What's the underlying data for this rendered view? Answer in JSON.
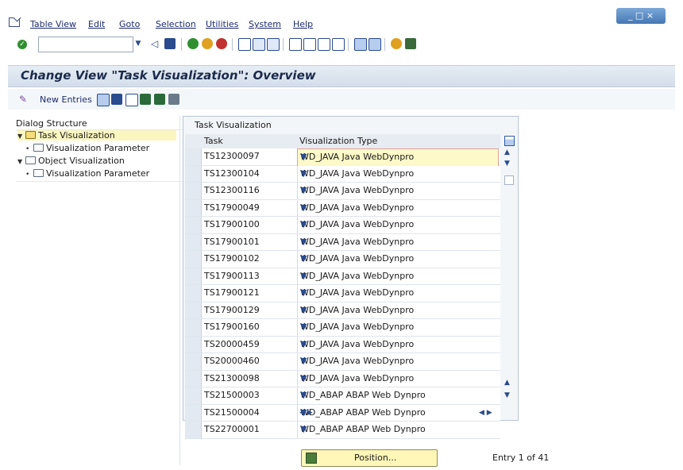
{
  "menu": {
    "items": [
      "Table View",
      "Edit",
      "Goto",
      "Selection",
      "Utilities",
      "System",
      "Help"
    ]
  },
  "window_controls": "_ □ ×",
  "title": "Change View \"Task Visualization\": Overview",
  "app_toolbar": {
    "new_entries": "New Entries"
  },
  "dialog": {
    "header": "Dialog Structure",
    "items": [
      {
        "label": "Task Visualization",
        "level": 0,
        "expanded": true,
        "selected": true
      },
      {
        "label": "Visualization Parameter",
        "level": 1
      },
      {
        "label": "Object Visualization",
        "level": 0,
        "expanded": true
      },
      {
        "label": "Visualization Parameter",
        "level": 1
      }
    ]
  },
  "table": {
    "title": "Task Visualization",
    "col_task": "Task",
    "col_type": "Visualization Type",
    "rows": [
      {
        "task": "TS12300097",
        "type": "WD_JAVA Java WebDynpro"
      },
      {
        "task": "TS12300104",
        "type": "WD_JAVA Java WebDynpro"
      },
      {
        "task": "TS12300116",
        "type": "WD_JAVA Java WebDynpro"
      },
      {
        "task": "TS17900049",
        "type": "WD_JAVA Java WebDynpro"
      },
      {
        "task": "TS17900100",
        "type": "WD_JAVA Java WebDynpro"
      },
      {
        "task": "TS17900101",
        "type": "WD_JAVA Java WebDynpro"
      },
      {
        "task": "TS17900102",
        "type": "WD_JAVA Java WebDynpro"
      },
      {
        "task": "TS17900113",
        "type": "WD_JAVA Java WebDynpro"
      },
      {
        "task": "TS17900121",
        "type": "WD_JAVA Java WebDynpro"
      },
      {
        "task": "TS17900129",
        "type": "WD_JAVA Java WebDynpro"
      },
      {
        "task": "TS17900160",
        "type": "WD_JAVA Java WebDynpro"
      },
      {
        "task": "TS20000459",
        "type": "WD_JAVA Java WebDynpro"
      },
      {
        "task": "TS20000460",
        "type": "WD_JAVA Java WebDynpro"
      },
      {
        "task": "TS21300098",
        "type": "WD_JAVA Java WebDynpro"
      },
      {
        "task": "TS21500003",
        "type": "WD_ABAP ABAP Web Dynpro"
      },
      {
        "task": "TS21500004",
        "type": "WD_ABAP ABAP Web Dynpro"
      },
      {
        "task": "TS22700001",
        "type": "WD_ABAP ABAP Web Dynpro"
      }
    ]
  },
  "position_button": "Position...",
  "entry_info": "Entry 1 of 41",
  "colors": {
    "title_bg": "#dbe4ee",
    "selected_tree": "#fbf6c0",
    "position_button": "#fff6b8",
    "active_cell": "#fdf9c8"
  }
}
